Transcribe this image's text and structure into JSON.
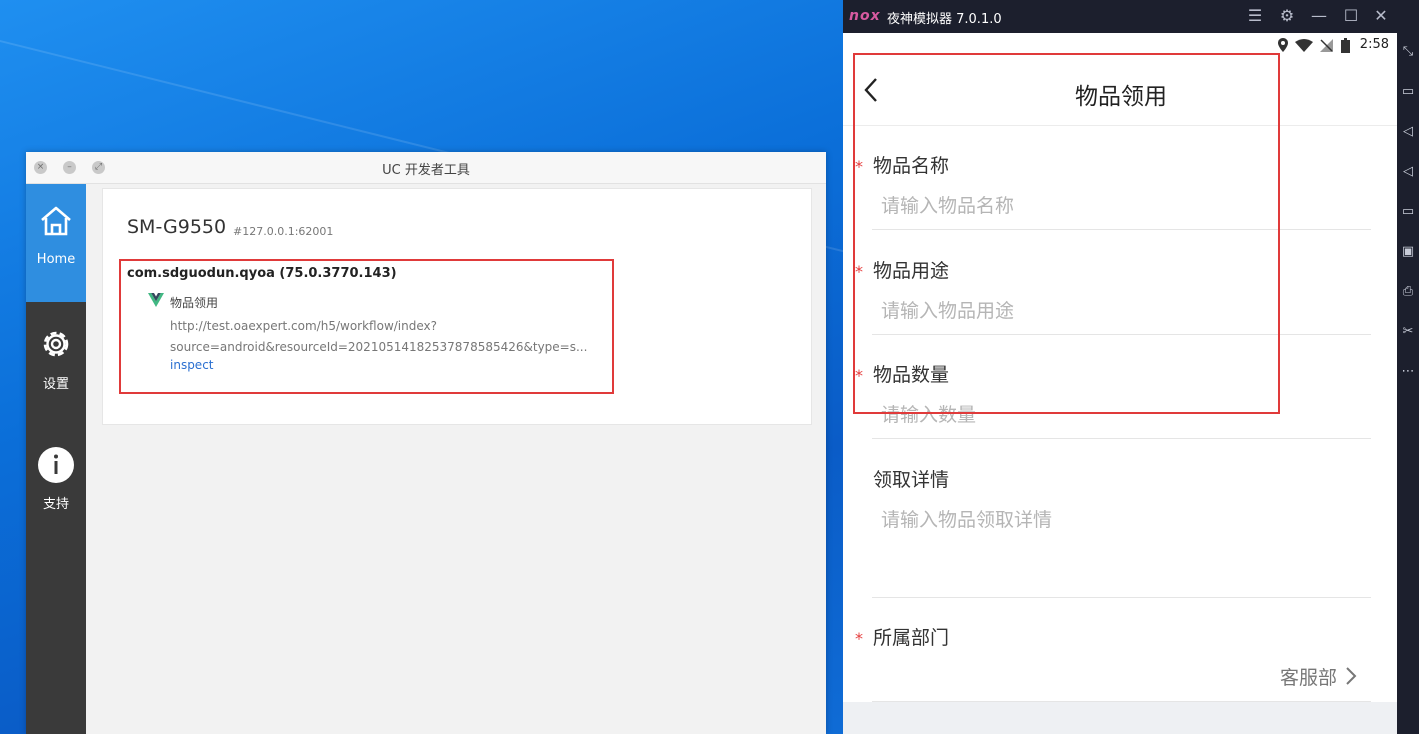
{
  "uc": {
    "window_title": "UC 开发者工具",
    "window_controls": {
      "close": "×",
      "minimize": "–",
      "maximize": "⤢"
    },
    "sidebar": [
      {
        "label": "Home",
        "icon": "home-icon",
        "active": true
      },
      {
        "label": "设置",
        "icon": "gear-icon",
        "active": false
      },
      {
        "label": "支持",
        "icon": "info-icon",
        "active": false
      }
    ],
    "device": {
      "name": "SM-G9550",
      "address": "#127.0.0.1:62001"
    },
    "app": {
      "package": "com.sdguodun.qyoa (75.0.3770.143)",
      "page_title": "物品领用",
      "url_line1": "http://test.oaexpert.com/h5/workflow/index?",
      "url_line2": "source=android&resourceId=20210514182537878585426&type=s...",
      "inspect_label": "inspect"
    }
  },
  "nox": {
    "logo": "nox",
    "title": "夜神模拟器 7.0.1.0",
    "controls": [
      "☰",
      "⚙",
      "—",
      "☐",
      "✕"
    ],
    "status_time": "2:58"
  },
  "form": {
    "title": "物品领用",
    "fields": [
      {
        "label": "物品名称",
        "placeholder": "请输入物品名称",
        "required": true
      },
      {
        "label": "物品用途",
        "placeholder": "请输入物品用途",
        "required": true
      },
      {
        "label": "物品数量",
        "placeholder": "请输入数量",
        "required": true
      },
      {
        "label": "领取详情",
        "placeholder": "请输入物品领取详情",
        "required": false
      }
    ],
    "department": {
      "label": "所属部门",
      "value": "客服部",
      "required": true
    },
    "required_mark": "*"
  },
  "colors": {
    "accent_blue": "#2f8ee0",
    "highlight_red": "#e03a3a",
    "required_red": "#e53c3c"
  }
}
